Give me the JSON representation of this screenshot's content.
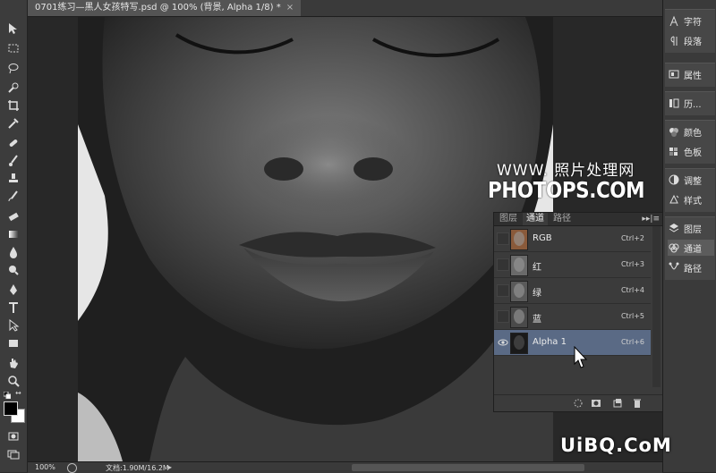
{
  "document": {
    "tab_title": "0701练习—黑人女孩特写.psd @ 100% (背景, Alpha 1/8) *",
    "close_glyph": "×"
  },
  "watermark": {
    "line1": "WWW. 照片处理网",
    "line2": "PHOTOPS.COM"
  },
  "corner_watermark": "UiBQ.CoM",
  "channels_panel": {
    "tabs": [
      "图层",
      "通道",
      "路径"
    ],
    "active_tab": 1,
    "menu_glyph": "▸▸|≡",
    "channels": [
      {
        "name": "RGB",
        "shortcut": "Ctrl+2",
        "visible": false,
        "selected": false
      },
      {
        "name": "红",
        "shortcut": "Ctrl+3",
        "visible": false,
        "selected": false
      },
      {
        "name": "绿",
        "shortcut": "Ctrl+4",
        "visible": false,
        "selected": false
      },
      {
        "name": "蓝",
        "shortcut": "Ctrl+5",
        "visible": false,
        "selected": false
      },
      {
        "name": "Alpha 1",
        "shortcut": "Ctrl+6",
        "visible": true,
        "selected": true
      }
    ],
    "footer_icons": [
      "load-selection-icon",
      "save-selection-icon",
      "new-channel-icon",
      "delete-channel-icon"
    ]
  },
  "dock": {
    "items": [
      {
        "label": "字符",
        "icon": "character-icon"
      },
      {
        "label": "段落",
        "icon": "paragraph-icon"
      },
      {
        "label": "属性",
        "icon": "properties-icon"
      },
      {
        "label": "历...",
        "icon": "history-icon"
      },
      {
        "label": "颜色",
        "icon": "color-icon"
      },
      {
        "label": "色板",
        "icon": "swatches-icon"
      },
      {
        "label": "调整",
        "icon": "adjustments-icon"
      },
      {
        "label": "样式",
        "icon": "styles-icon"
      },
      {
        "label": "图层",
        "icon": "layers-icon"
      },
      {
        "label": "通道",
        "icon": "channels-icon"
      },
      {
        "label": "路径",
        "icon": "paths-icon"
      }
    ]
  },
  "statusbar": {
    "zoom": "100%",
    "doc_info": "文档:1.90M/16.2M",
    "arrow_glyph": "▸"
  },
  "colors": {
    "selected_row": "#5a6a85",
    "panel_bg": "#3b3b3b",
    "dock_bg": "#3a3a3a"
  }
}
